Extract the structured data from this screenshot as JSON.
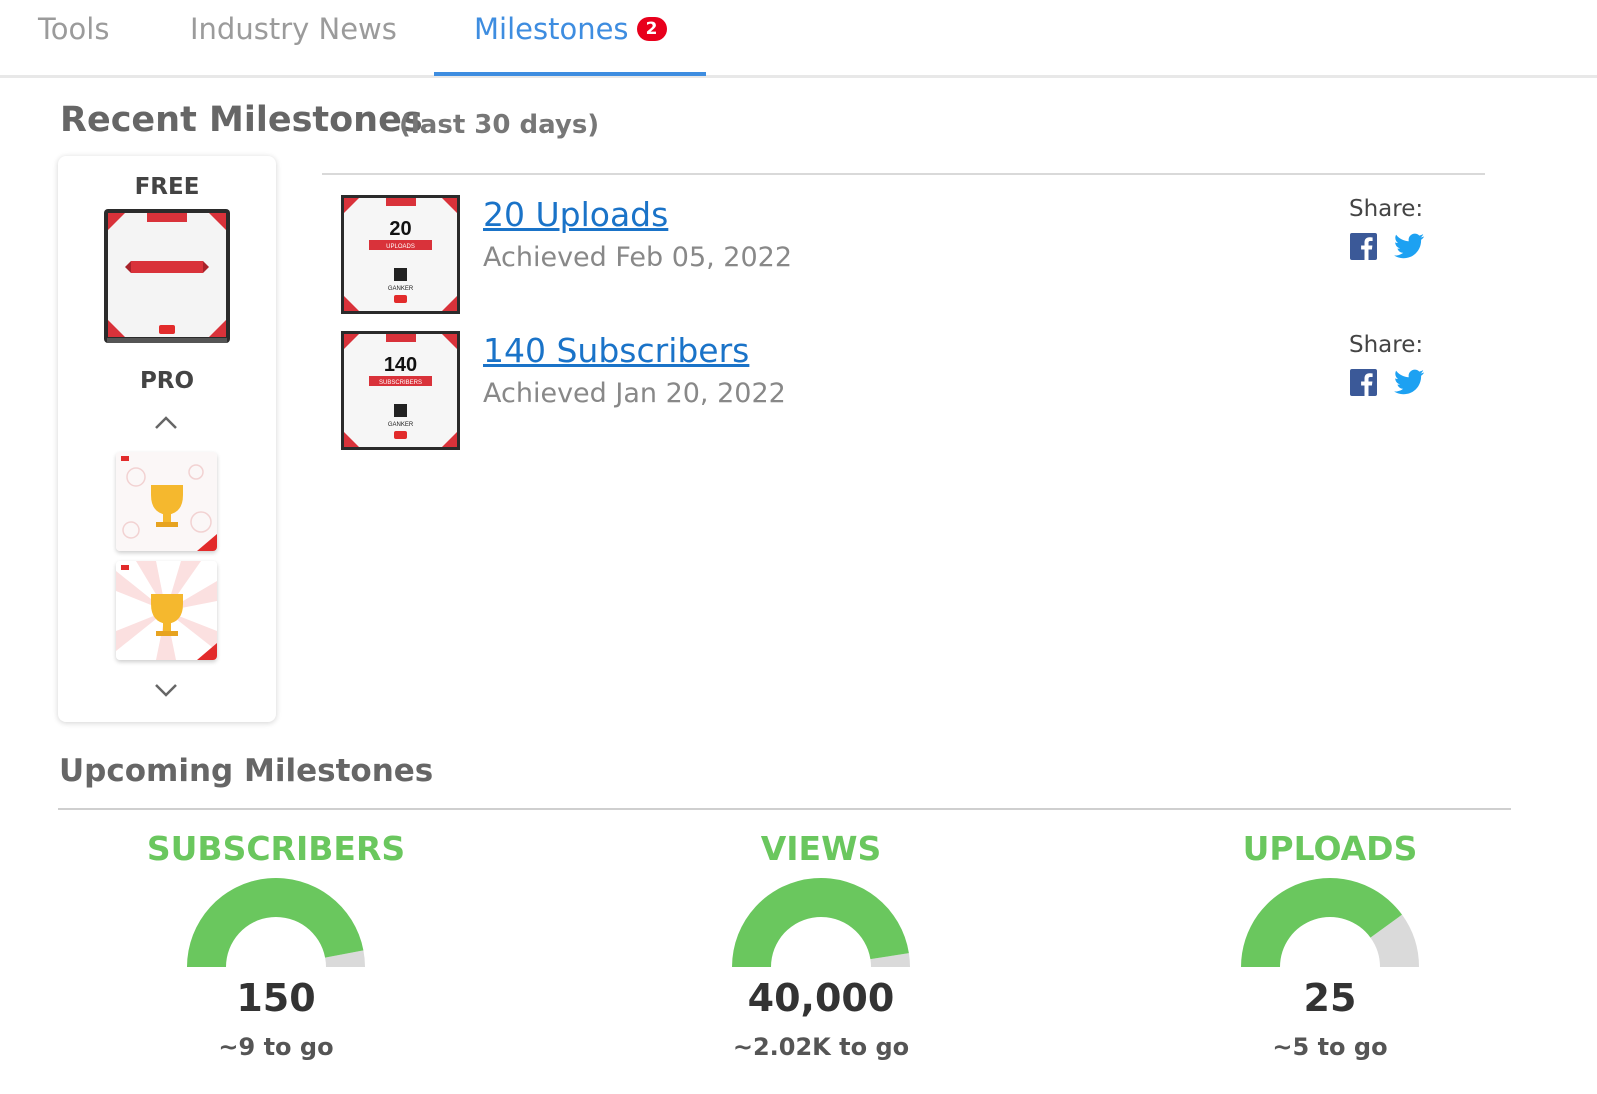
{
  "tabs": {
    "tools": "Tools",
    "industry_news": "Industry News",
    "milestones": "Milestones",
    "milestones_badge": "2"
  },
  "recent": {
    "title": "Recent Milestones",
    "subtitle": "(last 30 days)",
    "templates": {
      "free_label": "FREE",
      "pro_label": "PRO"
    },
    "items": [
      {
        "title": "20 Uploads",
        "achieved": "Achieved Feb 05, 2022",
        "share_label": "Share:",
        "thumb_value": "20",
        "thumb_banner": "UPLOADS",
        "thumb_channel": "GANKER"
      },
      {
        "title": "140 Subscribers",
        "achieved": "Achieved Jan 20, 2022",
        "share_label": "Share:",
        "thumb_value": "140",
        "thumb_banner": "SUBSCRIBERS",
        "thumb_channel": "GANKER"
      }
    ]
  },
  "upcoming": {
    "title": "Upcoming Milestones",
    "gauges": [
      {
        "title": "SUBSCRIBERS",
        "value": "150",
        "to_go": "~9 to go",
        "progress": 0.94
      },
      {
        "title": "VIEWS",
        "value": "40,000",
        "to_go": "~2.02K to go",
        "progress": 0.95
      },
      {
        "title": "UPLOADS",
        "value": "25",
        "to_go": "~5 to go",
        "progress": 0.8
      }
    ]
  },
  "colors": {
    "accent": "#3e8de0",
    "badge": "#e8001c",
    "gauge_fill": "#6ac75e",
    "gauge_track": "#dadada",
    "link": "#1a73c8",
    "facebook": "#3b5998",
    "twitter": "#1da1f2"
  }
}
